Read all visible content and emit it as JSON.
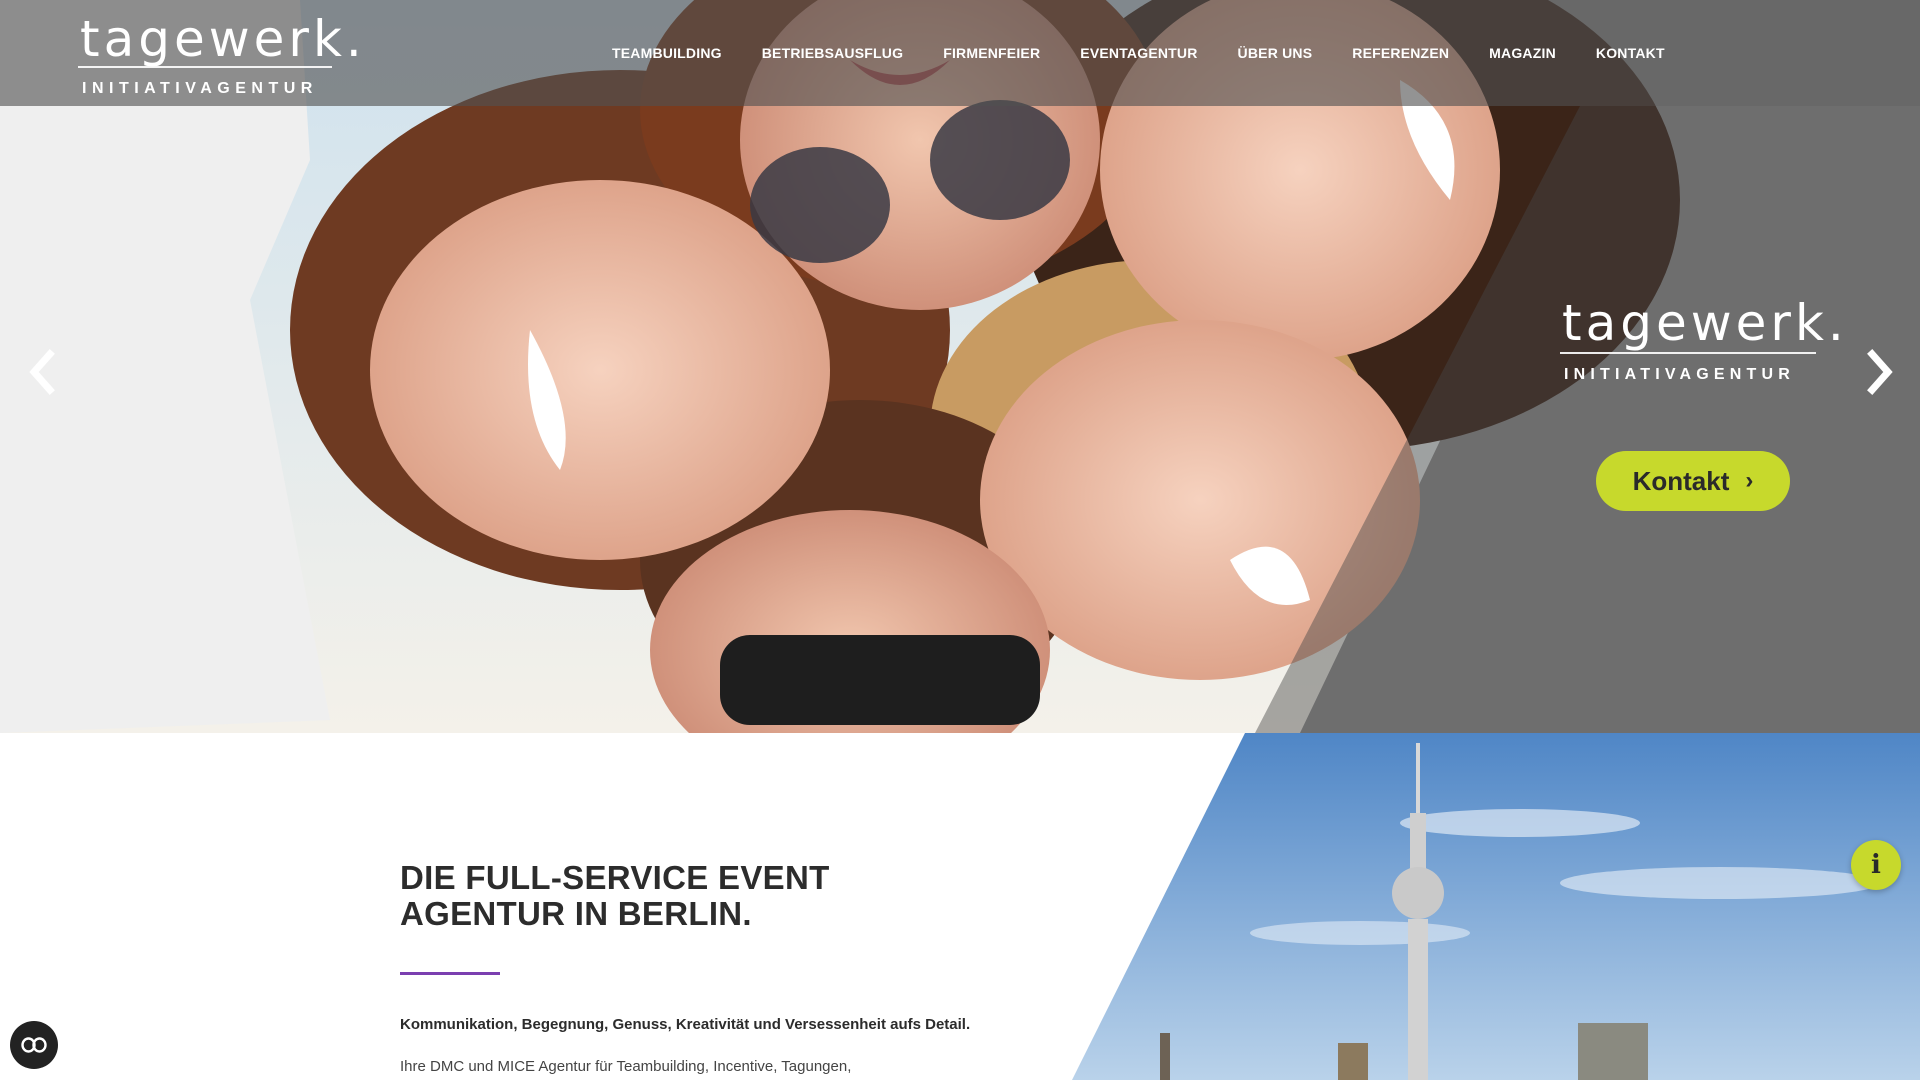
{
  "brand": {
    "logo_word": "tagewerk.",
    "logo_sub": "INITIATIVAGENTUR"
  },
  "nav": {
    "items": [
      {
        "label": "TEAMBUILDING"
      },
      {
        "label": "BETRIEBSAUSFLUG"
      },
      {
        "label": "FIRMENFEIER"
      },
      {
        "label": "EVENTAGENTUR"
      },
      {
        "label": "ÜBER UNS"
      },
      {
        "label": "REFERENZEN"
      },
      {
        "label": "MAGAZIN"
      },
      {
        "label": "KONTAKT"
      }
    ]
  },
  "hero": {
    "overlay_logo_word": "tagewerk.",
    "overlay_logo_sub": "INITIATIVAGENTUR",
    "cta_label": "Kontakt",
    "prev_icon": "chevron-left-icon",
    "next_icon": "chevron-right-icon"
  },
  "section": {
    "title_line1": "DIE FULL-SERVICE EVENT",
    "title_line2": "AGENTUR IN BERLIN.",
    "intro_bold": "Kommunikation, Begegnung, Genuss, Kreativität und Versessenheit aufs Detail.",
    "intro_text": "Ihre DMC und MICE Agentur für Teambuilding, Incentive, Tagungen,"
  },
  "widgets": {
    "info_icon": "info-icon",
    "accessibility_icon": "accessibility-icon"
  },
  "colors": {
    "accent_green": "#c7d92c",
    "accent_purple": "#7b3fb0",
    "header_overlay": "#505050"
  }
}
